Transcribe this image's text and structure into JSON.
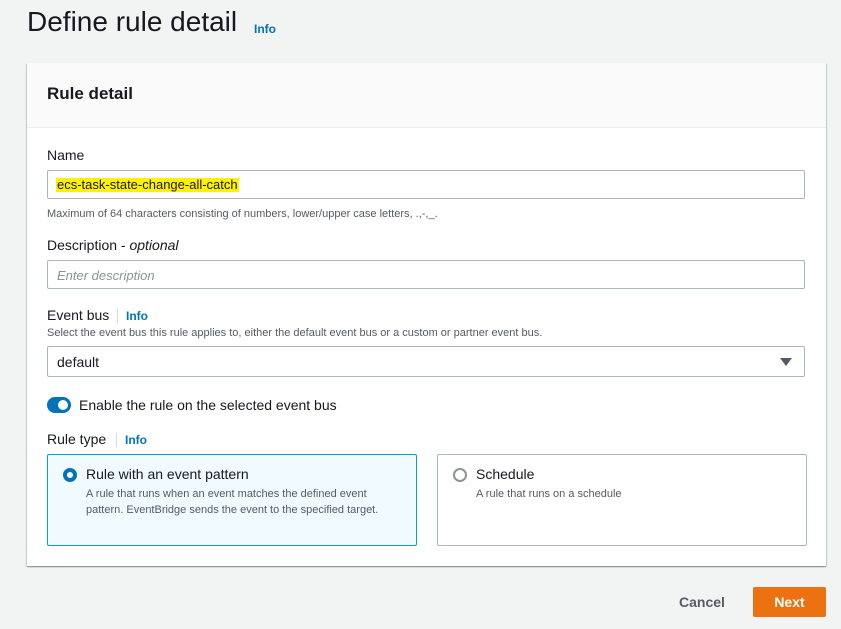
{
  "header": {
    "title": "Define rule detail",
    "info_label": "Info"
  },
  "card": {
    "title": "Rule detail",
    "name": {
      "label": "Name",
      "value": "ecs-task-state-change-all-catch",
      "hint": "Maximum of 64 characters consisting of numbers, lower/upper case letters, .,-,_."
    },
    "description": {
      "label": "Description - ",
      "label_optional": "optional",
      "placeholder": "Enter description"
    },
    "event_bus": {
      "label": "Event bus",
      "info_label": "Info",
      "hint": "Select the event bus this rule applies to, either the default event bus or a custom or partner event bus.",
      "selected": "default"
    },
    "enable_toggle": {
      "label": "Enable the rule on the selected event bus",
      "enabled": true
    },
    "rule_type": {
      "label": "Rule type",
      "info_label": "Info",
      "options": [
        {
          "title": "Rule with an event pattern",
          "description": "A rule that runs when an event matches the defined event pattern. EventBridge sends the event to the specified target.",
          "selected": true
        },
        {
          "title": "Schedule",
          "description": "A rule that runs on a schedule",
          "selected": false
        }
      ]
    }
  },
  "footer": {
    "cancel_label": "Cancel",
    "next_label": "Next"
  },
  "colors": {
    "accent": "#0073bb",
    "primary_button": "#ec7211",
    "highlight": "#fff200",
    "selected_tile_border": "#00a1c9"
  }
}
